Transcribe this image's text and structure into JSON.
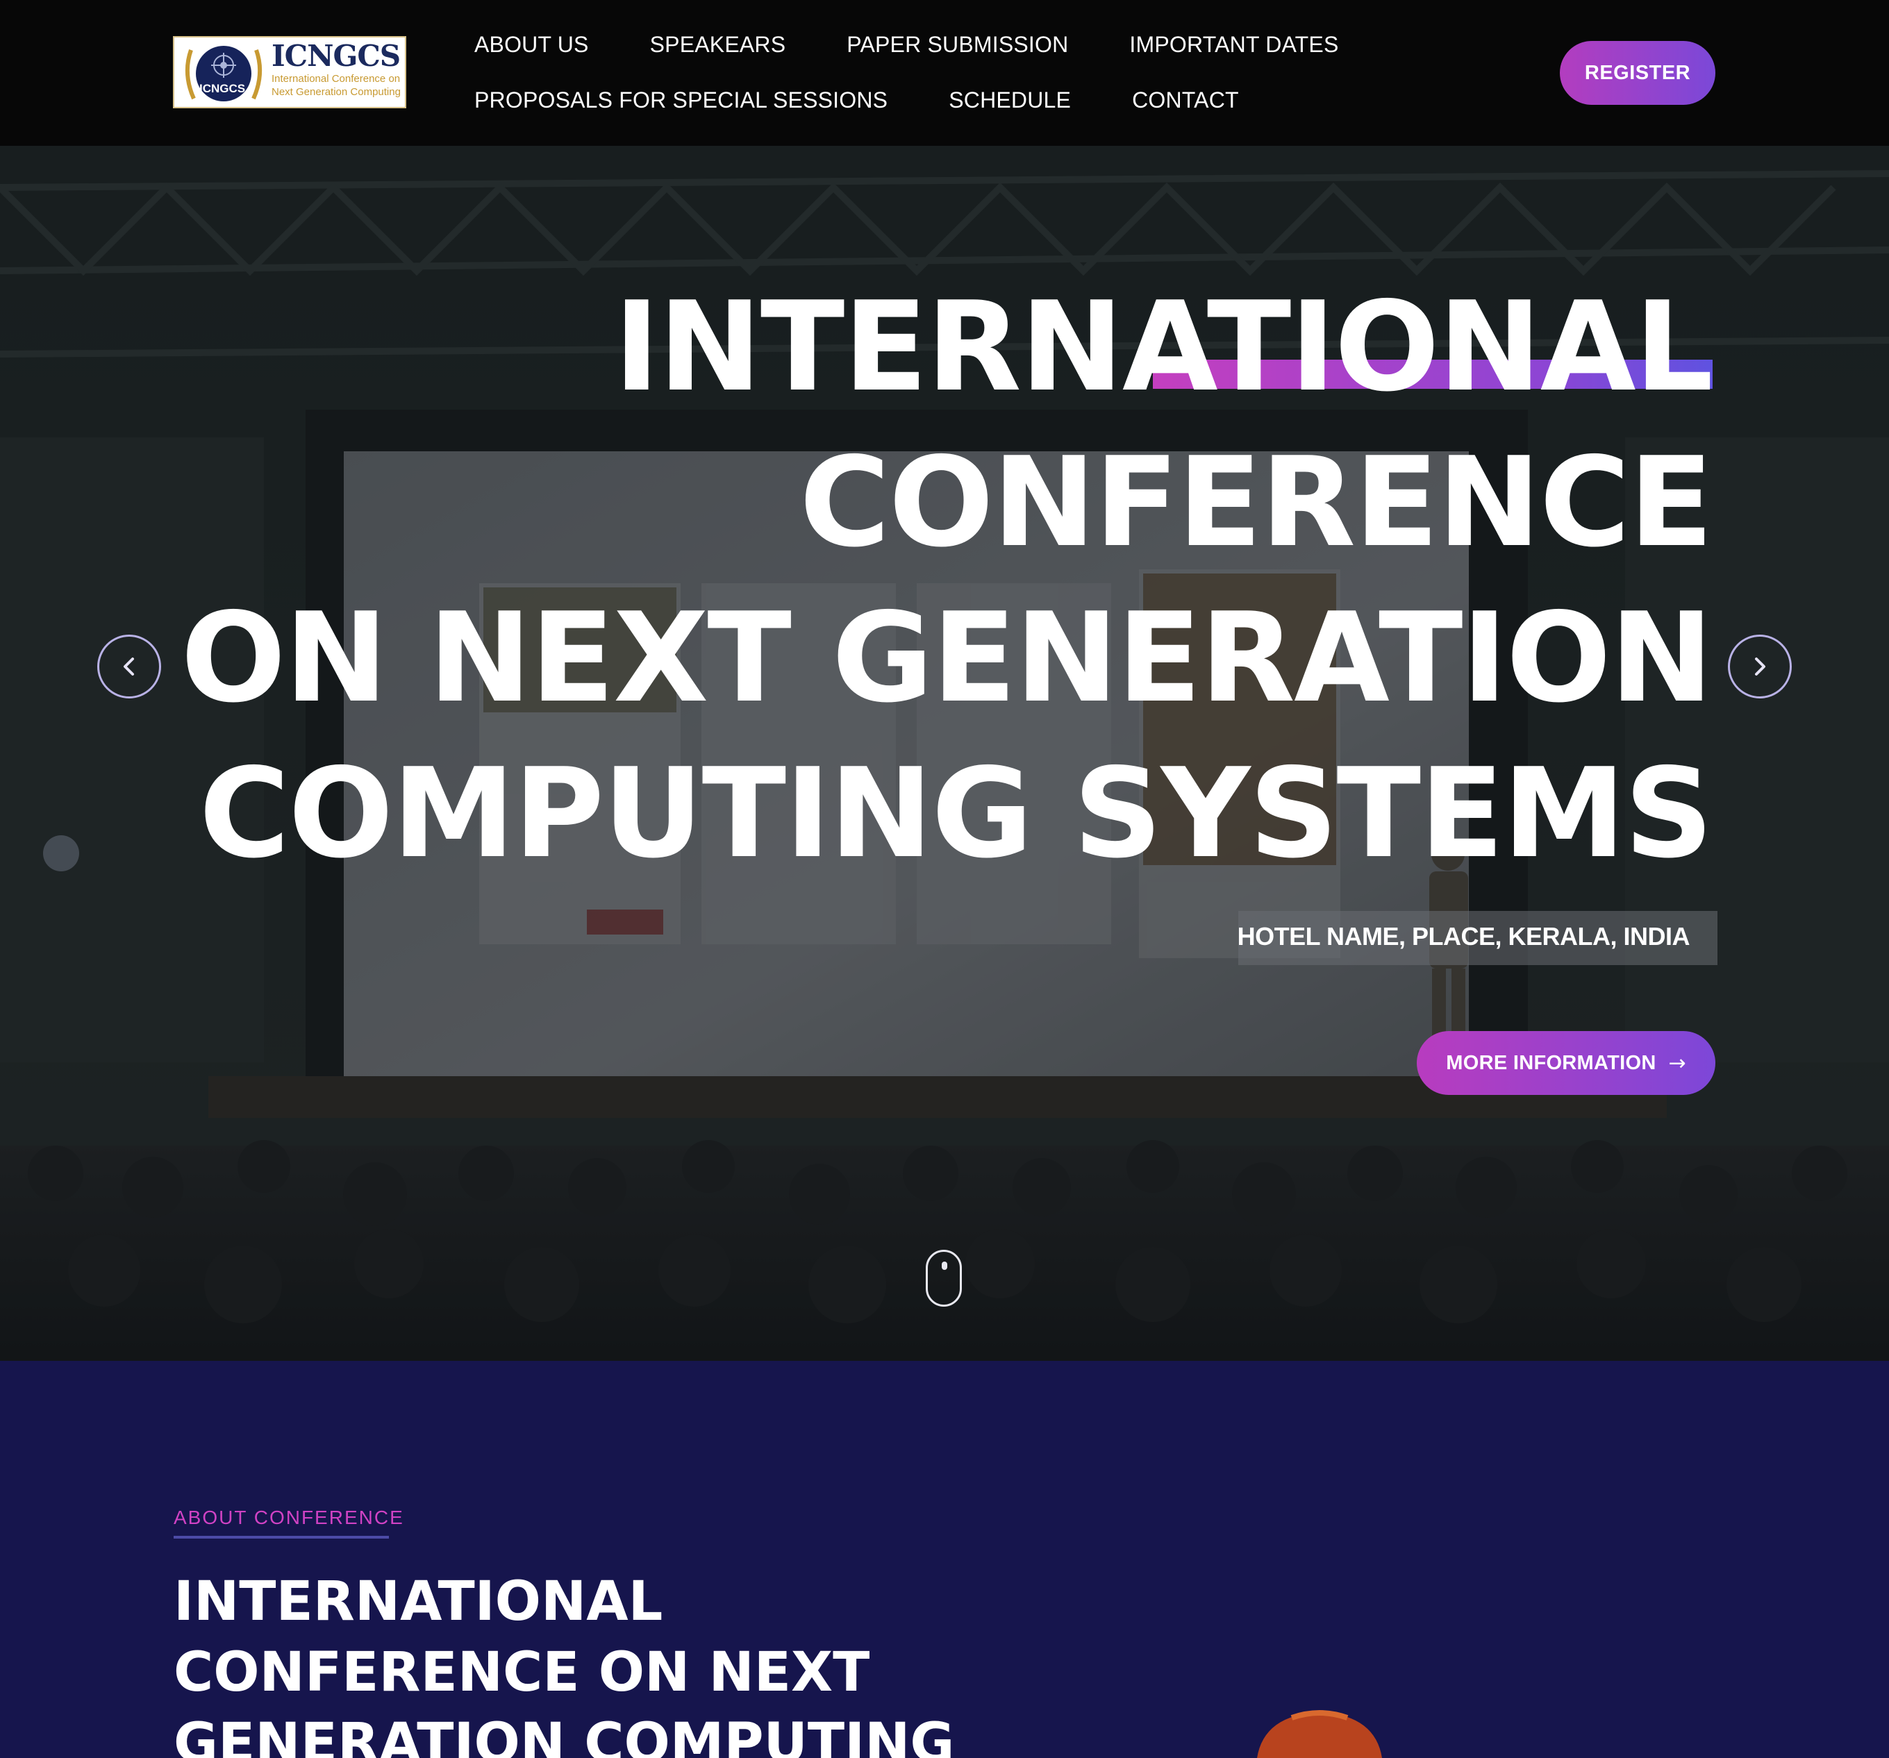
{
  "header": {
    "logo": {
      "title": "ICNGCS",
      "subtitle": "International Conference on Next Generation Computing",
      "seal_text": "ICNGCS"
    },
    "nav_row1": [
      "ABOUT US",
      "SPEAKEARS",
      "PAPER SUBMISSION",
      "IMPORTANT DATES"
    ],
    "nav_row2": [
      "PROPOSALS FOR SPECIAL SESSIONS",
      "SCHEDULE",
      "CONTACT"
    ],
    "register_label": "REGISTER"
  },
  "hero": {
    "title_lines": [
      "INTERNATIONAL",
      "CONFERENCE",
      "ON NEXT GENERATION",
      "COMPUTING SYSTEMS"
    ],
    "venue": "HOTEL NAME, PLACE, KERALA, INDIA",
    "cta_label": "MORE INFORMATION",
    "cta_arrow": "→",
    "prev_icon": "chevron-left-icon",
    "next_icon": "chevron-right-icon",
    "scroll_icon": "mouse-scroll-icon"
  },
  "about": {
    "tag": "ABOUT CONFERENCE",
    "title": "INTERNATIONAL CONFERENCE ON NEXT GENERATION COMPUTING"
  },
  "colors": {
    "header_bg": "#070707",
    "accent_magenta": "#c43fbf",
    "accent_violet": "#7b48d8",
    "about_bg": "#16154d",
    "tag_color": "#d042c4"
  }
}
